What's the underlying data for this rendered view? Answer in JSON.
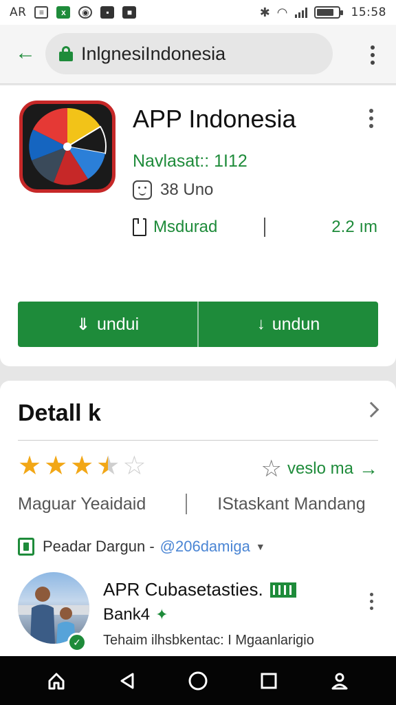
{
  "status_bar": {
    "left_text": "AR",
    "time": "15:58",
    "icons": [
      "document-icon",
      "excel-icon",
      "settings-icon",
      "media-icon",
      "square-icon"
    ],
    "battery_level": 0.8
  },
  "address_bar": {
    "url": "InlgnesiIndonesia"
  },
  "app": {
    "title": "APP Indonesia",
    "version": "Navlasat:: 1I12",
    "rating_text": "38 Uno",
    "meta_label": "Msdurad",
    "size": "2.2 ım"
  },
  "buttons": {
    "download_left": "undui",
    "download_right": "undun"
  },
  "detail": {
    "title": "Detall k",
    "rating_value": 3.5,
    "review_link": "veslo ma",
    "meta_left": "Maguar Yeaidaid",
    "meta_right": "IStaskant Mandang",
    "developer_label": "Peadar Dargun -",
    "developer_handle": "@206damiga",
    "profile_name": "APR Cubasetasties.",
    "profile_sub": "Bank4",
    "profile_desc": "Tehaim ilhsbkentac: I Mgaanlarigio"
  },
  "colors": {
    "accent": "#1e8b3a",
    "star": "#f2a716",
    "link": "#4a85d4"
  }
}
